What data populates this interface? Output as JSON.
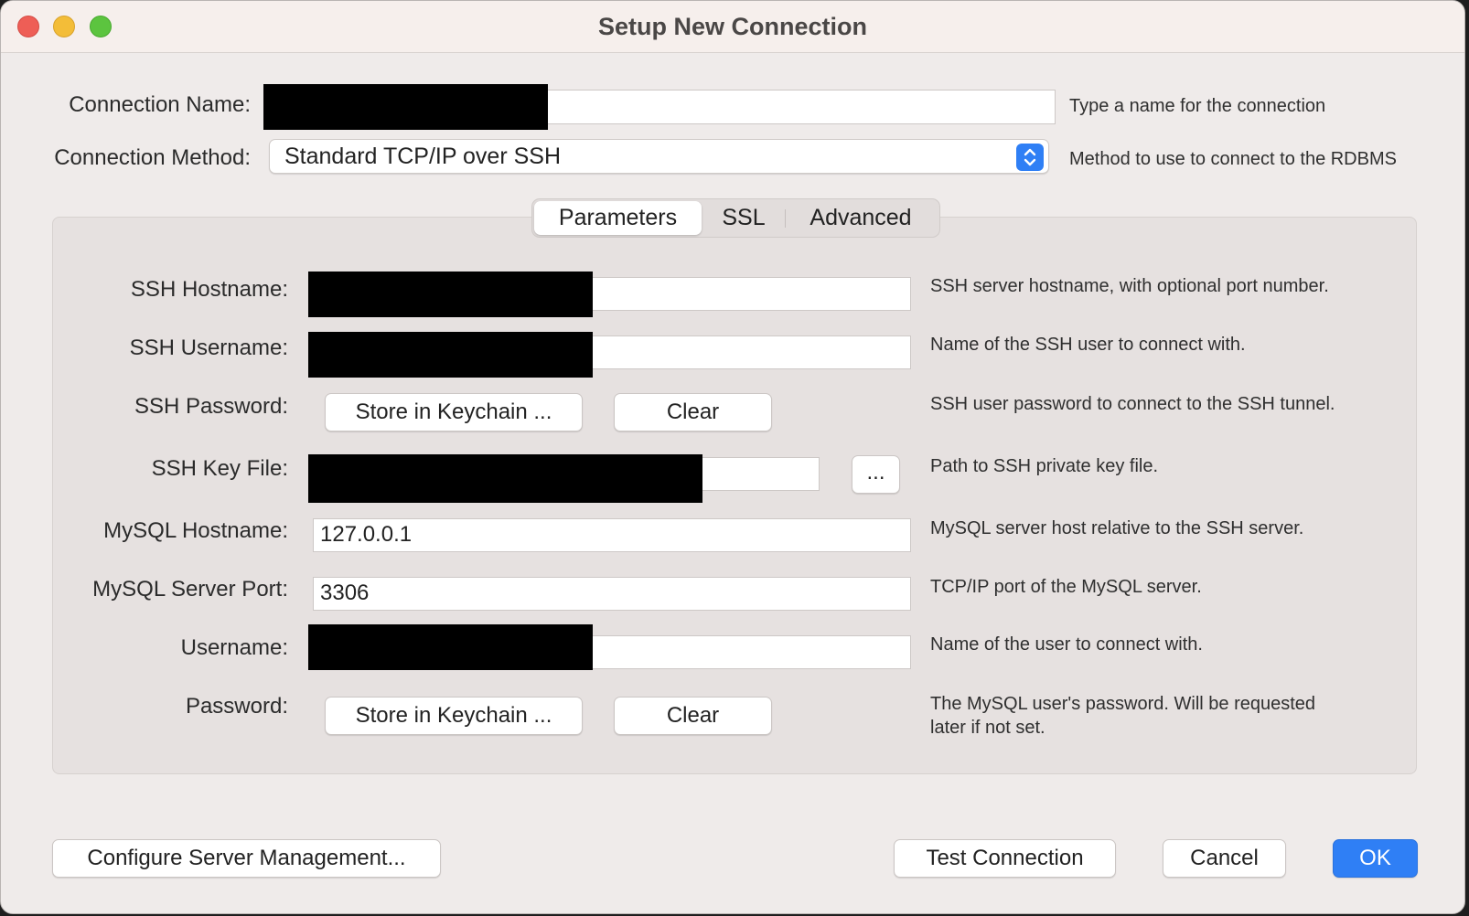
{
  "window": {
    "title": "Setup New Connection"
  },
  "top": {
    "connection_name_label": "Connection Name:",
    "connection_name_hint": "Type a name for the connection",
    "connection_method_label": "Connection Method:",
    "connection_method_value": "Standard TCP/IP over SSH",
    "connection_method_hint": "Method to use to connect to the RDBMS"
  },
  "tabs": {
    "parameters": "Parameters",
    "ssl": "SSL",
    "advanced": "Advanced",
    "active": "Parameters"
  },
  "params": {
    "ssh_hostname_label": "SSH Hostname:",
    "ssh_hostname_hint": "SSH server hostname, with  optional port number.",
    "ssh_username_label": "SSH Username:",
    "ssh_username_hint": "Name of the SSH user to connect with.",
    "ssh_password_label": "SSH Password:",
    "ssh_password_hint": "SSH user password to connect to the SSH tunnel.",
    "ssh_keyfile_label": "SSH Key File:",
    "ssh_keyfile_browse": "...",
    "ssh_keyfile_hint": "Path to SSH private key file.",
    "mysql_hostname_label": "MySQL Hostname:",
    "mysql_hostname_value": "127.0.0.1",
    "mysql_hostname_hint": "MySQL server host relative to the SSH server.",
    "mysql_port_label": "MySQL Server Port:",
    "mysql_port_value": "3306",
    "mysql_port_hint": "TCP/IP port of the MySQL server.",
    "username_label": "Username:",
    "username_hint": "Name of the user to connect with.",
    "password_label": "Password:",
    "password_hint_line1": "The MySQL user's password. Will be requested",
    "password_hint_line2": "later if not set.",
    "store_in_keychain": "Store in Keychain ...",
    "clear": "Clear"
  },
  "footer": {
    "configure_server_management": "Configure Server Management...",
    "test_connection": "Test Connection",
    "cancel": "Cancel",
    "ok": "OK"
  },
  "colors": {
    "accent": "#2f7ff5",
    "window_bg": "#efebea",
    "group_bg": "#e6e1e0"
  }
}
